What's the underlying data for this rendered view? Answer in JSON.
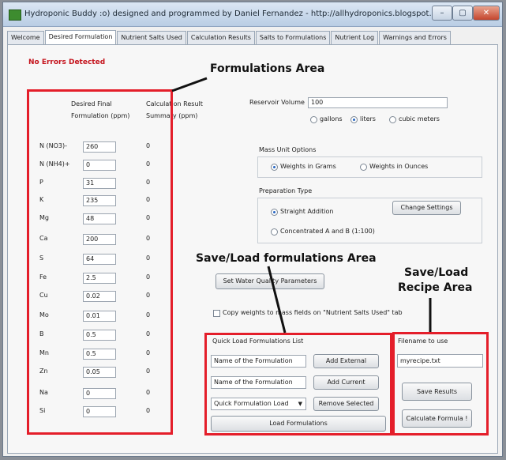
{
  "window": {
    "title": "Hydroponic Buddy :o) designed and programmed by Daniel Fernandez - http://allhydroponics.blogspot.com",
    "minimize": "–",
    "maximize": "▢",
    "close": "✕"
  },
  "tabs": [
    {
      "label": "Welcome",
      "active": false
    },
    {
      "label": "Desired Formulation",
      "active": true
    },
    {
      "label": "Nutrient Salts Used",
      "active": false
    },
    {
      "label": "Calculation Results",
      "active": false
    },
    {
      "label": "Salts to Formulations",
      "active": false
    },
    {
      "label": "Nutrient Log",
      "active": false
    },
    {
      "label": "Warnings and Errors",
      "active": false
    }
  ],
  "status": {
    "text": "No Errors Detected",
    "color": "#c5141d"
  },
  "formulations": {
    "header_desired_1": "Desired Final",
    "header_desired_2": "Formulation (ppm)",
    "header_result_1": "Calculation Result",
    "header_result_2": "Summary (ppm)",
    "rows": [
      {
        "element": "N (NO3)-",
        "value": "260",
        "result": "0"
      },
      {
        "element": "N (NH4)+",
        "value": "0",
        "result": "0"
      },
      {
        "element": "P",
        "value": "31",
        "result": "0"
      },
      {
        "element": "K",
        "value": "235",
        "result": "0"
      },
      {
        "element": "Mg",
        "value": "48",
        "result": "0"
      },
      {
        "element": "Ca",
        "value": "200",
        "result": "0"
      },
      {
        "element": "S",
        "value": "64",
        "result": "0"
      },
      {
        "element": "Fe",
        "value": "2.5",
        "result": "0"
      },
      {
        "element": "Cu",
        "value": "0.02",
        "result": "0"
      },
      {
        "element": "Mo",
        "value": "0.01",
        "result": "0"
      },
      {
        "element": "B",
        "value": "0.5",
        "result": "0"
      },
      {
        "element": "Mn",
        "value": "0.5",
        "result": "0"
      },
      {
        "element": "Zn",
        "value": "0.05",
        "result": "0"
      },
      {
        "element": "Na",
        "value": "0",
        "result": "0"
      },
      {
        "element": "Si",
        "value": "0",
        "result": "0"
      }
    ]
  },
  "reservoir": {
    "label": "Reservoir Volume",
    "value": "100",
    "units": [
      {
        "label": "gallons",
        "selected": false
      },
      {
        "label": "liters",
        "selected": true
      },
      {
        "label": "cubic meters",
        "selected": false
      }
    ]
  },
  "mass_unit": {
    "title": "Mass Unit Options",
    "options": [
      {
        "label": "Weights in Grams",
        "selected": true
      },
      {
        "label": "Weights in Ounces",
        "selected": false
      }
    ]
  },
  "preparation": {
    "title": "Preparation Type",
    "options": [
      {
        "label": "Straight Addition",
        "selected": true
      },
      {
        "label": "Concentrated A and B (1:100)",
        "selected": false
      }
    ],
    "change_settings": "Change Settings"
  },
  "water_quality_button": "Set Water Quality Parameters",
  "copy_weights": {
    "label": "Copy weights to mass fields on \"Nutrient Salts Used\" tab",
    "checked": false
  },
  "quick_load": {
    "title": "Quick Load Formulations List",
    "name_field_1": "Name of the Formulation",
    "name_field_2": "Name of the Formulation",
    "add_external": "Add External",
    "add_current": "Add Current",
    "dropdown_value": "Quick Formulation Load",
    "remove_selected": "Remove Selected",
    "load_formulations": "Load Formulations"
  },
  "recipe": {
    "filename_label": "Filename to use",
    "filename_value": "myrecipe.txt",
    "save_results": "Save Results",
    "calculate": "Calculate Formula !"
  },
  "annotations": {
    "formulations_area": "Formulations Area",
    "save_load_formulations_area": "Save/Load formulations Area",
    "save_load_recipe_line1": "Save/Load",
    "save_load_recipe_line2": "Recipe Area"
  },
  "colors": {
    "annotation_box": "#e41e2a",
    "radio_selected": "#2464c2"
  }
}
